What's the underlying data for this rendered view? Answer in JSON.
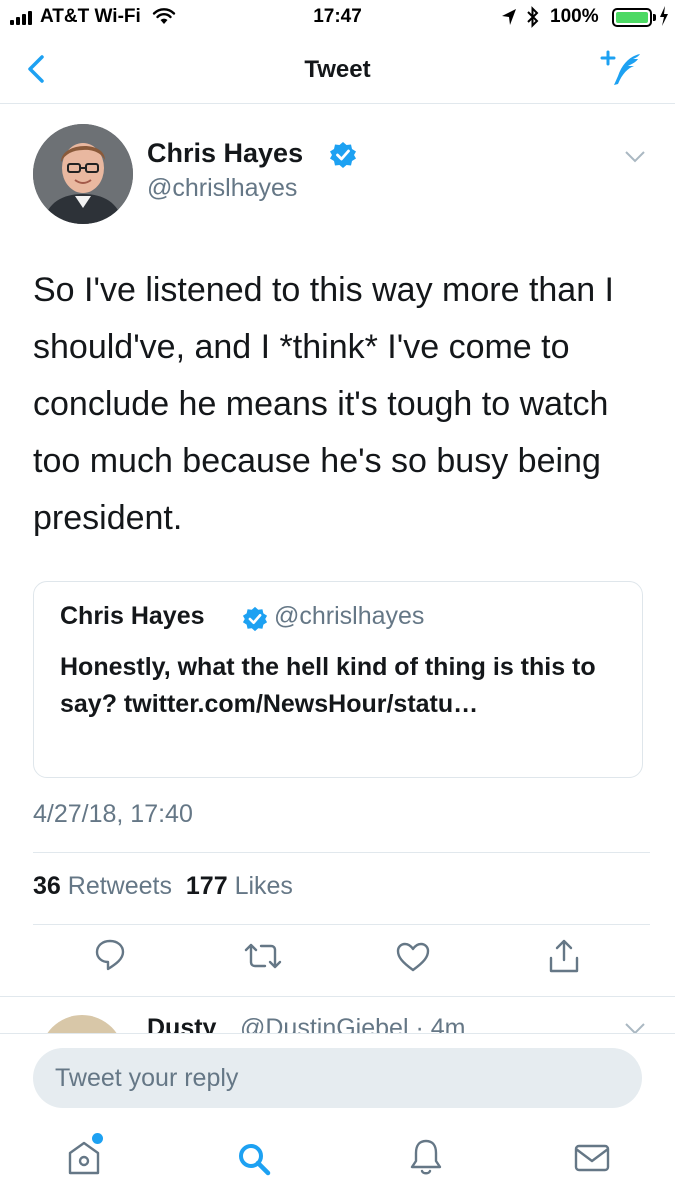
{
  "status_bar": {
    "carrier": "AT&T Wi-Fi",
    "time": "17:47",
    "battery_percent": "100%",
    "battery_level": 1.0
  },
  "nav": {
    "title": "Tweet",
    "back_icon": "chevron-left-icon",
    "compose_icon": "compose-tweet-icon"
  },
  "tweet": {
    "author_name": "Chris Hayes",
    "author_handle": "@chrislhayes",
    "verified": true,
    "text": "So I've listened to this way more than I should've, and I *think* I've come to conclude he means it's tough to watch too much because he's so busy being president.",
    "timestamp": "4/27/18, 17:40",
    "retweets_count": "36",
    "retweets_label": "Retweets",
    "likes_count": "177",
    "likes_label": "Likes"
  },
  "quoted_tweet": {
    "author_name": "Chris Hayes",
    "author_handle": "@chrislhayes",
    "text": "Honestly, what the hell kind of thing is this to say? twitter.com/NewsHour/statu…"
  },
  "next_reply": {
    "author_name": "Dusty",
    "meta": "@DustinGiebel · 4m"
  },
  "reply_box": {
    "placeholder": "Tweet your reply"
  },
  "tab_bar": {
    "items": [
      "home-icon",
      "search-icon",
      "notifications-icon",
      "messages-icon"
    ]
  },
  "colors": {
    "accent": "#1da1f2",
    "secondary_text": "#657786",
    "divider": "#e1e8ed",
    "battery": "#4cd964"
  }
}
